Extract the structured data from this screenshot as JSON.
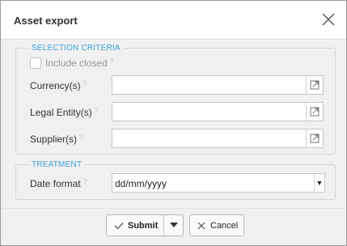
{
  "dialog": {
    "title": "Asset export",
    "close_icon": "close-icon"
  },
  "selection_criteria": {
    "legend": "SELECTION CRITERIA",
    "include_closed": {
      "label": "Include closed",
      "checked": false,
      "help": "?"
    },
    "fields": [
      {
        "label": "Currency(s)",
        "help": "?",
        "value": "",
        "picker_icon": "open-picker-icon"
      },
      {
        "label": "Legal Entity(s)",
        "help": "?",
        "value": "",
        "picker_icon": "open-picker-icon"
      },
      {
        "label": "Supplier(s)",
        "help": "?",
        "value": "",
        "picker_icon": "open-picker-icon"
      }
    ]
  },
  "treatment": {
    "legend": "TREATMENT",
    "date_format": {
      "label": "Date format",
      "help": "?",
      "value": "dd/mm/yyyy"
    }
  },
  "actions": {
    "submit_label": "Submit",
    "cancel_label": "Cancel"
  },
  "colors": {
    "accent": "#3aa0d8"
  }
}
